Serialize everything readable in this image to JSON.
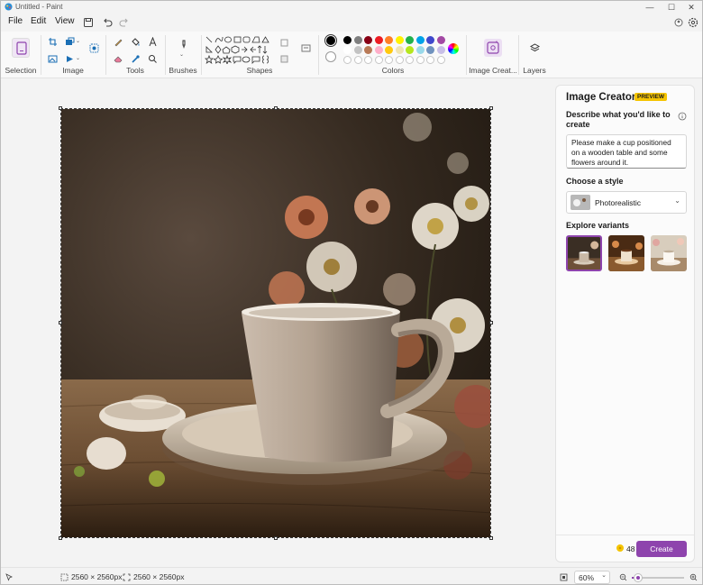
{
  "window": {
    "title": "Untitled - Paint"
  },
  "menu": {
    "file": "File",
    "edit": "Edit",
    "view": "View"
  },
  "ribbon": {
    "selection": "Selection",
    "image": "Image",
    "tools": "Tools",
    "brushes": "Brushes",
    "shapes": "Shapes",
    "colors": "Colors",
    "image_creator": "Image Creat...",
    "layers": "Layers"
  },
  "palette": {
    "row1": [
      "#000000",
      "#7f7f7f",
      "#880015",
      "#ed1c24",
      "#ff7f27",
      "#fff200",
      "#22b14c",
      "#00a2e8",
      "#3f48cc",
      "#a349a4"
    ],
    "row2": [
      "#ffffff",
      "#c3c3c3",
      "#b97a57",
      "#ffaec9",
      "#ffc90e",
      "#efe4b0",
      "#b5e61d",
      "#99d9ea",
      "#7092be",
      "#c8bfe7"
    ],
    "primary": "#000000",
    "secondary": "#ffffff",
    "empty_count": 10
  },
  "panel": {
    "title": "Image Creator",
    "badge": "PREVIEW",
    "describe_label": "Describe what you'd like to create",
    "prompt": "Please make a cup positioned on a wooden table and some flowers around it.",
    "style_label": "Choose a style",
    "style_value": "Photorealistic",
    "variants_label": "Explore variants",
    "credits": "48",
    "create": "Create"
  },
  "status": {
    "selection_size": "2560 × 2560px",
    "canvas_size": "2560 × 2560px",
    "zoom": "60%"
  },
  "accent": "#8e44ad"
}
